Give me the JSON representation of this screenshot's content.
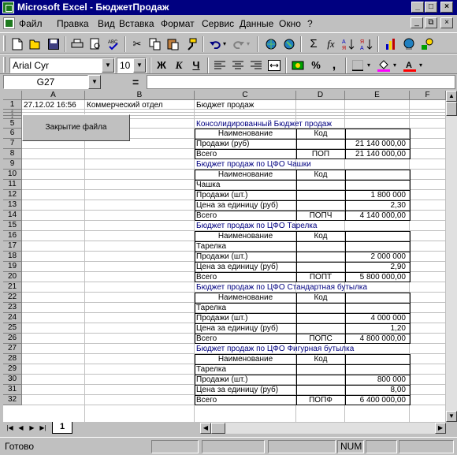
{
  "window": {
    "title": "Microsoft Excel - БюджетПродаж",
    "buttons": [
      "_",
      "□",
      "×"
    ]
  },
  "menu": {
    "items": [
      "Файл",
      "Правка",
      "Вид",
      "Вставка",
      "Формат",
      "Сервис",
      "Данные",
      "Окно",
      "?"
    ],
    "doc_buttons": [
      "_",
      "⧉",
      "×"
    ]
  },
  "format_toolbar": {
    "font": "Arial Cyr",
    "size": "10",
    "bold": "Ж",
    "italic": "К",
    "underline": "Ч",
    "percent": "%",
    "comma": ","
  },
  "standard_toolbar": {
    "sum": "Σ",
    "function": "fx"
  },
  "formula_bar": {
    "name_box": "G27",
    "equals": "=",
    "value": ""
  },
  "columns": [
    "A",
    "B",
    "C",
    "D",
    "E",
    "F"
  ],
  "rows": [
    "1",
    "2",
    "3",
    "4",
    "5",
    "6",
    "7",
    "8",
    "9",
    "10",
    "11",
    "12",
    "13",
    "14",
    "15",
    "16",
    "17",
    "18",
    "19",
    "20",
    "21",
    "22",
    "23",
    "24",
    "25",
    "26",
    "27",
    "28",
    "29",
    "30",
    "31",
    "32"
  ],
  "sheet": {
    "r1": {
      "a": "27.12.02 16:56",
      "b": "Коммерческий отдел",
      "c": "Бюджет продаж"
    },
    "close_button": "Закрытие файла",
    "blocks": [
      {
        "title": "Консолидированный Бюджет продаж",
        "h_name": "Наименование",
        "h_code": "Код",
        "rows": [
          {
            "name": "Продажи (руб)",
            "code": "",
            "value": "21 140 000,00"
          },
          {
            "name": "Всего",
            "code": "ПОП",
            "value": "21 140 000,00"
          }
        ]
      },
      {
        "title": "Бюджет продаж по ЦФО Чашки",
        "h_name": "Наименование",
        "h_code": "Код",
        "rows": [
          {
            "name": "Чашка",
            "code": "",
            "value": ""
          },
          {
            "name": "Продажи (шт.)",
            "code": "",
            "value": "1 800 000"
          },
          {
            "name": "Цена за единицу (руб)",
            "code": "",
            "value": "2,30"
          },
          {
            "name": "Всего",
            "code": "ПОПЧ",
            "value": "4 140 000,00"
          }
        ]
      },
      {
        "title": "Бюджет продаж по ЦФО Тарелка",
        "h_name": "Наименование",
        "h_code": "Код",
        "rows": [
          {
            "name": "Тарелка",
            "code": "",
            "value": ""
          },
          {
            "name": "Продажи (шт.)",
            "code": "",
            "value": "2 000 000"
          },
          {
            "name": "Цена за единицу (руб)",
            "code": "",
            "value": "2,90"
          },
          {
            "name": "Всего",
            "code": "ПОПТ",
            "value": "5 800 000,00"
          }
        ]
      },
      {
        "title": "Бюджет продаж по ЦФО Стандартная бутылка",
        "h_name": "Наименование",
        "h_code": "Код",
        "rows": [
          {
            "name": "Тарелка",
            "code": "",
            "value": ""
          },
          {
            "name": "Продажи (шт.)",
            "code": "",
            "value": "4 000 000"
          },
          {
            "name": "Цена за единицу (руб)",
            "code": "",
            "value": "1,20"
          },
          {
            "name": "Всего",
            "code": "ПОПС",
            "value": "4 800 000,00"
          }
        ]
      },
      {
        "title": "Бюджет продаж по ЦФО Фигурная бутылка",
        "h_name": "Наименование",
        "h_code": "Код",
        "rows": [
          {
            "name": "Тарелка",
            "code": "",
            "value": ""
          },
          {
            "name": "Продажи (шт.)",
            "code": "",
            "value": "800 000"
          },
          {
            "name": "Цена за единицу (руб)",
            "code": "",
            "value": "8,00"
          },
          {
            "name": "Всего",
            "code": "ПОПФ",
            "value": "6 400 000,00"
          }
        ]
      }
    ]
  },
  "sheet_tabs": [
    "1"
  ],
  "status": {
    "text": "Готово",
    "num": "NUM"
  },
  "colors": {
    "titlebar": "#000080",
    "block_title": "#000080",
    "face": "#c0c0c0"
  }
}
